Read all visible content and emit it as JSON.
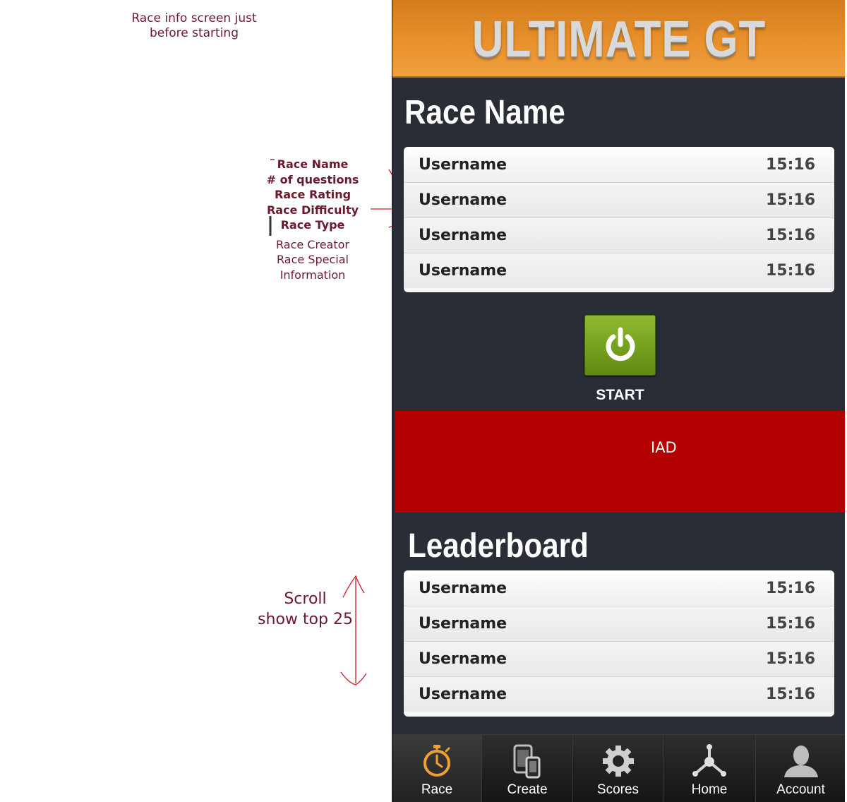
{
  "annotations": {
    "top_note": [
      "Race  info screen just",
      "before starting"
    ],
    "field_list": [
      "Race Name",
      "# of questions",
      "Race Rating",
      "Race Difficulty",
      "Race Type"
    ],
    "extra_fields": [
      "Race Creator",
      "Race Special",
      "Information"
    ],
    "scroll_note": [
      "Scroll",
      "show top 25"
    ]
  },
  "app": {
    "title": "ULTIMATE GT",
    "race_title": "Race Name",
    "race_rows": [
      {
        "name": "Username",
        "time": "15:16"
      },
      {
        "name": "Username",
        "time": "15:16"
      },
      {
        "name": "Username",
        "time": "15:16"
      },
      {
        "name": "Username",
        "time": "15:16"
      }
    ],
    "start_label": "START",
    "ad_label": "IAD",
    "leaderboard_title": "Leaderboard",
    "leaderboard_rows": [
      {
        "name": "Username",
        "time": "15:16"
      },
      {
        "name": "Username",
        "time": "15:16"
      },
      {
        "name": "Username",
        "time": "15:16"
      },
      {
        "name": "Username",
        "time": "15:16"
      }
    ]
  },
  "tabs": [
    {
      "label": "Race",
      "icon": "stopwatch-icon",
      "active": true
    },
    {
      "label": "Create",
      "icon": "devices-icon",
      "active": false
    },
    {
      "label": "Scores",
      "icon": "gear-icon",
      "active": false
    },
    {
      "label": "Home",
      "icon": "hub-icon",
      "active": false
    },
    {
      "label": "Account",
      "icon": "user-icon",
      "active": false
    }
  ],
  "colors": {
    "header_orange": "#e9922e",
    "panel_dark": "#292d36",
    "ad_red": "#b30000",
    "start_green": "#6f9a1c",
    "annotation_text": "#6b1a2c",
    "annotation_pen": "#d01a2a",
    "active_icon": "#f0a030"
  }
}
